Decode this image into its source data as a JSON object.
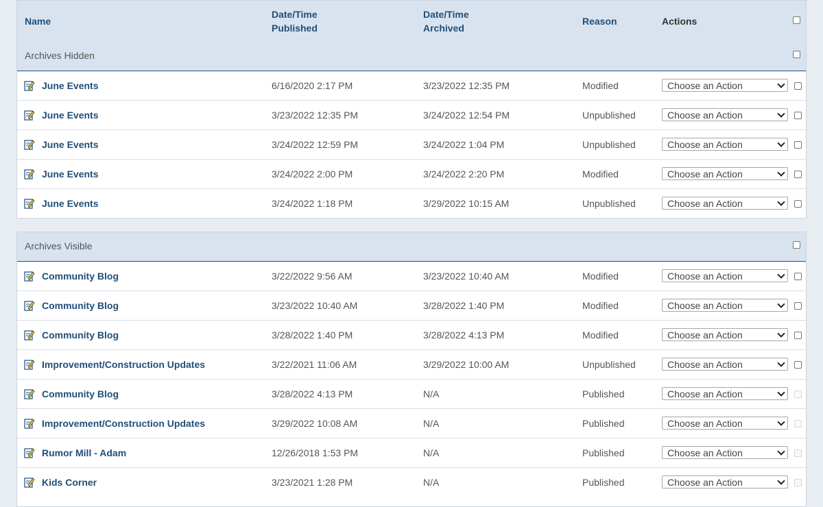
{
  "columns": {
    "name": "Name",
    "published_line1": "Date/Time",
    "published_line2": "Published",
    "archived_line1": "Date/Time",
    "archived_line2": "Archived",
    "reason": "Reason",
    "actions": "Actions"
  },
  "sections": [
    {
      "title": "Archives Hidden",
      "rows": [
        {
          "name": "June Events",
          "published": "6/16/2020 2:17 PM",
          "archived": "3/23/2022 12:35 PM",
          "reason": "Modified",
          "action": "Choose an Action",
          "checkbox_enabled": true
        },
        {
          "name": "June Events",
          "published": "3/23/2022 12:35 PM",
          "archived": "3/24/2022 12:54 PM",
          "reason": "Unpublished",
          "action": "Choose an Action",
          "checkbox_enabled": true
        },
        {
          "name": "June Events",
          "published": "3/24/2022 12:59 PM",
          "archived": "3/24/2022 1:04 PM",
          "reason": "Unpublished",
          "action": "Choose an Action",
          "checkbox_enabled": true
        },
        {
          "name": "June Events",
          "published": "3/24/2022 2:00 PM",
          "archived": "3/24/2022 2:20 PM",
          "reason": "Modified",
          "action": "Choose an Action",
          "checkbox_enabled": true
        },
        {
          "name": "June Events",
          "published": "3/24/2022 1:18 PM",
          "archived": "3/29/2022 10:15 AM",
          "reason": "Unpublished",
          "action": "Choose an Action",
          "checkbox_enabled": true
        }
      ]
    },
    {
      "title": "Archives Visible",
      "rows": [
        {
          "name": "Community Blog",
          "published": "3/22/2022 9:56 AM",
          "archived": "3/23/2022 10:40 AM",
          "reason": "Modified",
          "action": "Choose an Action",
          "checkbox_enabled": true
        },
        {
          "name": "Community Blog",
          "published": "3/23/2022 10:40 AM",
          "archived": "3/28/2022 1:40 PM",
          "reason": "Modified",
          "action": "Choose an Action",
          "checkbox_enabled": true
        },
        {
          "name": "Community Blog",
          "published": "3/28/2022 1:40 PM",
          "archived": "3/28/2022 4:13 PM",
          "reason": "Modified",
          "action": "Choose an Action",
          "checkbox_enabled": true
        },
        {
          "name": "Improvement/Construction Updates",
          "published": "3/22/2021 11:06 AM",
          "archived": "3/29/2022 10:00 AM",
          "reason": "Unpublished",
          "action": "Choose an Action",
          "checkbox_enabled": true
        },
        {
          "name": "Community Blog",
          "published": "3/28/2022 4:13 PM",
          "archived": "N/A",
          "reason": "Published",
          "action": "Choose an Action",
          "checkbox_enabled": false
        },
        {
          "name": "Improvement/Construction Updates",
          "published": "3/29/2022 10:08 AM",
          "archived": "N/A",
          "reason": "Published",
          "action": "Choose an Action",
          "checkbox_enabled": false
        },
        {
          "name": "Rumor Mill - Adam",
          "published": "12/26/2018 1:53 PM",
          "archived": "N/A",
          "reason": "Published",
          "action": "Choose an Action",
          "checkbox_enabled": false
        },
        {
          "name": "Kids Corner",
          "published": "3/23/2021 1:28 PM",
          "archived": "N/A",
          "reason": "Published",
          "action": "Choose an Action",
          "checkbox_enabled": false
        }
      ]
    }
  ],
  "icons": {
    "row_icon": "edit-page-icon"
  }
}
